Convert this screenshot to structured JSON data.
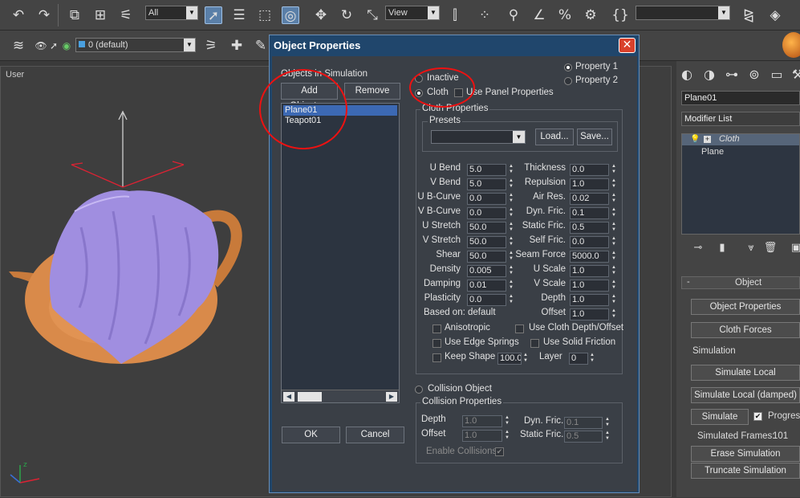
{
  "toolbar": {
    "selection_filter": "All",
    "reference_coord": "View",
    "layer_name": "0 (default)"
  },
  "viewport": {
    "label": "User",
    "axis_z": "z"
  },
  "command_panel": {
    "object_name": "Plane01",
    "modifier_list": "Modifier List",
    "stack": [
      "Cloth",
      "Plane"
    ],
    "rollout_title": "Object",
    "object_properties": "Object Properties",
    "cloth_forces": "Cloth Forces",
    "simulation_label": "Simulation",
    "simulate_local": "Simulate Local",
    "simulate_local_damped": "Simulate Local (damped)",
    "simulate": "Simulate",
    "progress": "Progress",
    "simulated_frames_label": "Simulated Frames:",
    "simulated_frames_value": "101",
    "erase_simulation": "Erase Simulation",
    "truncate_simulation": "Truncate Simulation"
  },
  "dialog": {
    "title": "Object Properties",
    "objects_in_sim_label": "Objects in Simulation",
    "add_objects": "Add Objects...",
    "remove": "Remove",
    "objects": [
      "Plane01",
      "Teapot01"
    ],
    "ok": "OK",
    "cancel": "Cancel",
    "property1": "Property 1",
    "property2": "Property 2",
    "inactive": "Inactive",
    "cloth": "Cloth",
    "use_panel_props": "Use Panel Properties",
    "cloth_properties": "Cloth Properties",
    "presets": "Presets",
    "load": "Load...",
    "save": "Save...",
    "left_params": [
      {
        "label": "U Bend",
        "value": "5.0"
      },
      {
        "label": "V Bend",
        "value": "5.0"
      },
      {
        "label": "U B-Curve",
        "value": "0.0"
      },
      {
        "label": "V B-Curve",
        "value": "0.0"
      },
      {
        "label": "U Stretch",
        "value": "50.0"
      },
      {
        "label": "V Stretch",
        "value": "50.0"
      },
      {
        "label": "Shear",
        "value": "50.0"
      },
      {
        "label": "Density",
        "value": "0.005"
      },
      {
        "label": "Damping",
        "value": "0.01"
      },
      {
        "label": "Plasticity",
        "value": "0.0"
      }
    ],
    "right_params": [
      {
        "label": "Thickness",
        "value": "0.0"
      },
      {
        "label": "Repulsion",
        "value": "1.0"
      },
      {
        "label": "Air Res.",
        "value": "0.02"
      },
      {
        "label": "Dyn. Fric.",
        "value": "0.1"
      },
      {
        "label": "Static Fric.",
        "value": "0.5"
      },
      {
        "label": "Self Fric.",
        "value": "0.0"
      },
      {
        "label": "Seam Force",
        "value": "5000.0"
      },
      {
        "label": "U Scale",
        "value": "1.0"
      },
      {
        "label": "V Scale",
        "value": "1.0"
      },
      {
        "label": "Depth",
        "value": "1.0"
      },
      {
        "label": "Offset",
        "value": "1.0"
      }
    ],
    "based_on": "Based on: default",
    "anisotropic": "Anisotropic",
    "use_cloth_depth_offset": "Use Cloth Depth/Offset",
    "use_edge_springs": "Use Edge Springs",
    "use_solid_friction": "Use Solid Friction",
    "keep_shape": "Keep Shape",
    "keep_shape_value": "100.0",
    "layer": "Layer",
    "layer_value": "0",
    "collision_object": "Collision Object",
    "collision_properties": "Collision Properties",
    "col_depth_label": "Depth",
    "col_depth": "1.0",
    "col_offset_label": "Offset",
    "col_offset": "1.0",
    "col_dyn_fric_label": "Dyn. Fric.",
    "col_dyn_fric": "0.1",
    "col_static_fric_label": "Static Fric.",
    "col_static_fric": "0.5",
    "enable_collisions": "Enable Collisions"
  },
  "colors": {
    "dialog_title_bar": "#20466c",
    "selection": "#3c69b4",
    "cloth_purple": "#a08ee0",
    "teapot_orange": "#d88a4a",
    "annotation_red": "#e11111"
  }
}
